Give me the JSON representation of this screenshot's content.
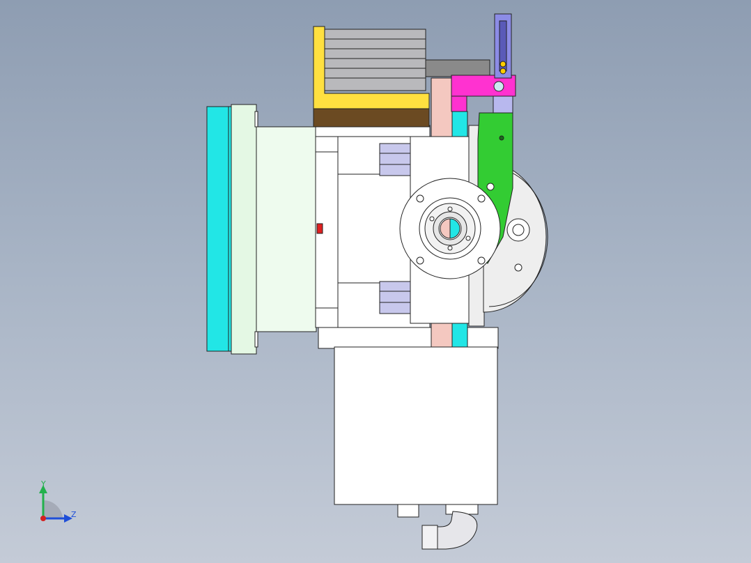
{
  "triad": {
    "y_label": "Y",
    "z_label": "Z",
    "y_color": "#22b14c",
    "z_color": "#1f4fd8",
    "origin_color": "#d42020"
  },
  "model": {
    "view": "Right view",
    "colors": {
      "bed_plate": "#22e6e6",
      "flange": "#e4f8e4",
      "body": "#ffffff",
      "cylinder_mount": "#ffe040",
      "brown_block": "#6b4a22",
      "magenta_arm": "#ff32d0",
      "lavender_bar": "#8c8ce6",
      "green_plate": "#33cc33",
      "pink_block": "#f4c8c0",
      "outline": "#222222"
    }
  }
}
